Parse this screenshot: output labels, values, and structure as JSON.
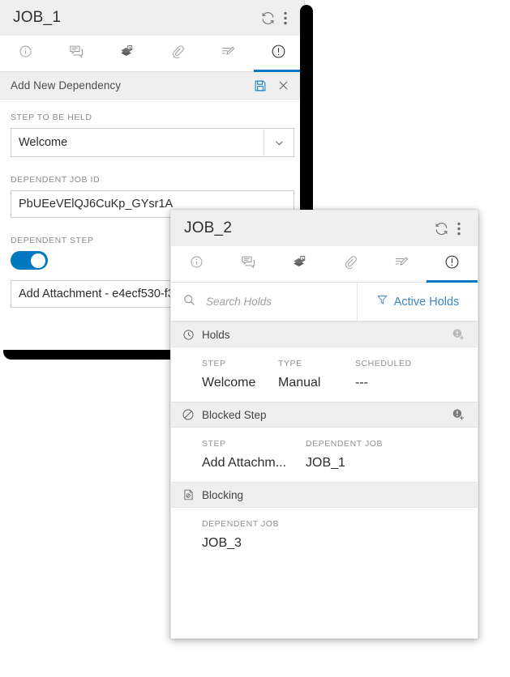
{
  "job1": {
    "title": "JOB_1",
    "titlebar_actions": [
      {
        "name": "refresh-icon",
        "label": "Refresh"
      },
      {
        "name": "more-options-icon",
        "label": "More options"
      }
    ],
    "tabs": [
      {
        "icon": "info-icon",
        "label": "Information",
        "active": false
      },
      {
        "icon": "comments-icon",
        "label": "Comments",
        "active": false
      },
      {
        "icon": "layers-icon",
        "label": "Related",
        "active": false
      },
      {
        "icon": "paperclip-icon",
        "label": "Attachments",
        "active": false
      },
      {
        "icon": "signature-icon",
        "label": "Notes",
        "active": false
      },
      {
        "icon": "exclamation-circle-icon",
        "label": "Holds",
        "active": true
      }
    ],
    "subheader": {
      "title": "Add New Dependency",
      "save_label": "Save",
      "close_label": "Close"
    },
    "fields": {
      "step_to_be_held_label": "STEP TO BE HELD",
      "step_to_be_held_value": "Welcome",
      "dependent_job_id_label": "DEPENDENT JOB ID",
      "dependent_job_id_value": "PbUEeVElQJ6CuKp_GYsr1A",
      "dependent_step_label": "DEPENDENT STEP",
      "dependent_step_toggle": "on",
      "dependent_step_value": "Add Attachment - e4ecf530-f3"
    }
  },
  "job2": {
    "title": "JOB_2",
    "titlebar_actions": [
      {
        "name": "refresh-icon",
        "label": "Refresh"
      },
      {
        "name": "more-options-icon",
        "label": "More options"
      }
    ],
    "tabs": [
      {
        "icon": "info-icon",
        "label": "Information",
        "active": false
      },
      {
        "icon": "comments-icon",
        "label": "Comments",
        "active": false
      },
      {
        "icon": "layers-icon",
        "label": "Related",
        "active": false
      },
      {
        "icon": "paperclip-icon",
        "label": "Attachments",
        "active": false
      },
      {
        "icon": "signature-icon",
        "label": "Notes",
        "active": false
      },
      {
        "icon": "exclamation-circle-icon",
        "label": "Holds",
        "active": true
      }
    ],
    "search": {
      "placeholder": "Search Holds",
      "value": ""
    },
    "filter": {
      "label": "Active Holds"
    },
    "sections": [
      {
        "icon": "clock-icon",
        "title": "Holds",
        "action_icon": "add-hold-icon",
        "columns": [
          "STEP",
          "TYPE",
          "SCHEDULED"
        ],
        "rows": [
          [
            "Welcome",
            "Manual",
            "---"
          ]
        ]
      },
      {
        "icon": "circle-slash-icon",
        "title": "Blocked Step",
        "action_icon": "add-blocked-step-icon",
        "columns": [
          "STEP",
          "DEPENDENT JOB"
        ],
        "rows": [
          [
            "Add Attachm...",
            "JOB_1"
          ]
        ]
      },
      {
        "icon": "document-slash-icon",
        "title": "Blocking",
        "action_icon": "",
        "columns": [
          "DEPENDENT JOB"
        ],
        "rows": [
          [
            "JOB_3"
          ]
        ]
      }
    ]
  },
  "colors": {
    "accent": "#0079c1",
    "link": "#3b87c9",
    "header_bg": "#efefef",
    "toggle_on": "#0079c1"
  }
}
